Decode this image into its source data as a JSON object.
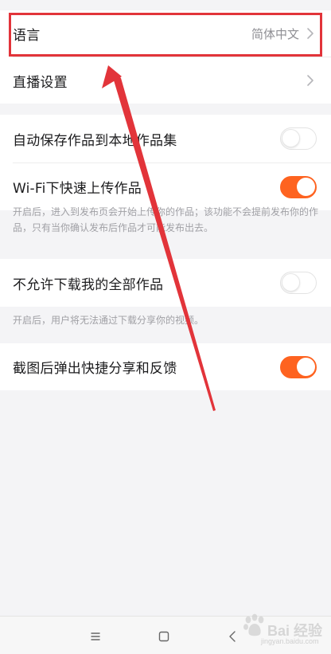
{
  "settings": {
    "language": {
      "label": "语言",
      "value": "简体中文"
    },
    "live": {
      "label": "直播设置"
    },
    "autosave": {
      "label": "自动保存作品到本地作品集",
      "on": false
    },
    "wifi_upload": {
      "label": "Wi-Fi下快速上传作品",
      "on": true,
      "hint": "开启后，进入到发布页会开始上传你的作品；该功能不会提前发布你的作品，只有当你确认发布后作品才可能发布出去。"
    },
    "no_download": {
      "label": "不允许下载我的全部作品",
      "on": false,
      "hint": "开启后，用户将无法通过下载分享你的视频。"
    },
    "screenshot_share": {
      "label": "截图后弹出快捷分享和反馈",
      "on": true
    }
  },
  "navbar": {
    "menu_icon": "menu-lines-icon",
    "home_icon": "square-home-icon",
    "back_icon": "back-chevron-icon"
  },
  "annotation": {
    "box_color": "#e2343a",
    "arrow_color": "#e2343a"
  },
  "watermark": {
    "text": "Bai 经验",
    "sub": "jingyan.baidu.com"
  },
  "colors": {
    "accent": "#fe6320",
    "background": "#f4f4f6",
    "card": "#ffffff"
  }
}
